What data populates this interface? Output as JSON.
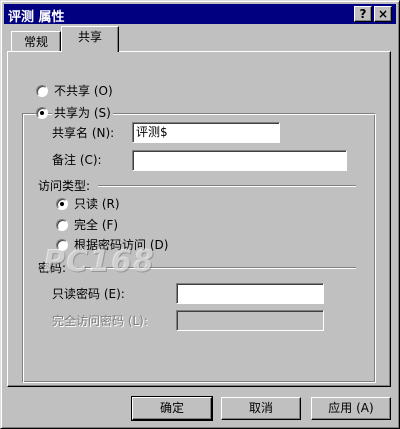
{
  "window": {
    "title": "评测 属性",
    "help_label": "?",
    "close_label": "×"
  },
  "tabs": [
    {
      "label": "常规",
      "active": false
    },
    {
      "label": "共享",
      "active": true
    }
  ],
  "share": {
    "no_share_label": "不共享 (O)",
    "share_as_label": "共享为 (S)",
    "selected": "share_as",
    "share_name_label": "共享名 (N):",
    "share_name_value": "评测$",
    "comment_label": "备注 (C):",
    "comment_value": ""
  },
  "access": {
    "heading": "访问类型:",
    "read_only_label": "只读 (R)",
    "full_label": "完全 (F)",
    "depends_label": "根据密码访问 (D)",
    "selected": "read_only"
  },
  "passwords": {
    "heading": "密码:",
    "read_only_label": "只读密码 (E):",
    "read_only_value": "",
    "full_label": "完全访问密码 (L):",
    "full_value": ""
  },
  "buttons": {
    "ok": "确定",
    "cancel": "取消",
    "apply": "应用 (A)"
  },
  "watermark": "PC168"
}
